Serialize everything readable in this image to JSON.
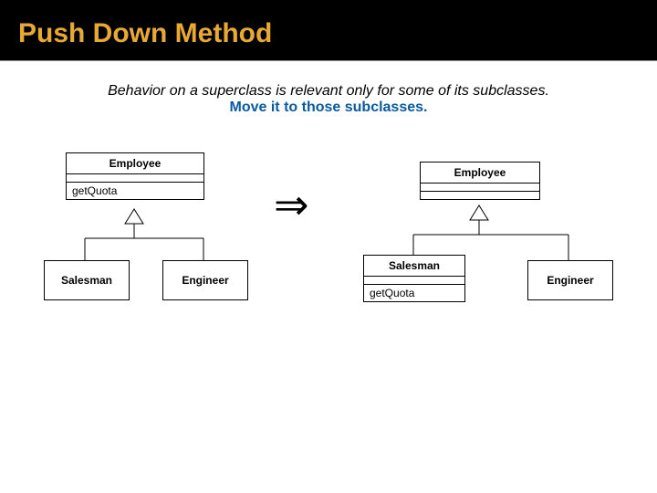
{
  "title": "Push Down Method",
  "description": {
    "line1": "Behavior on a superclass is relevant only for some of its subclasses.",
    "line2": "Move it to those subclasses."
  },
  "before": {
    "super": {
      "name": "Employee",
      "method": "getQuota"
    },
    "sub1": {
      "name": "Salesman"
    },
    "sub2": {
      "name": "Engineer"
    }
  },
  "after": {
    "super": {
      "name": "Employee"
    },
    "sub1": {
      "name": "Salesman",
      "method": "getQuota"
    },
    "sub2": {
      "name": "Engineer"
    }
  },
  "arrow_glyph": "⇒"
}
